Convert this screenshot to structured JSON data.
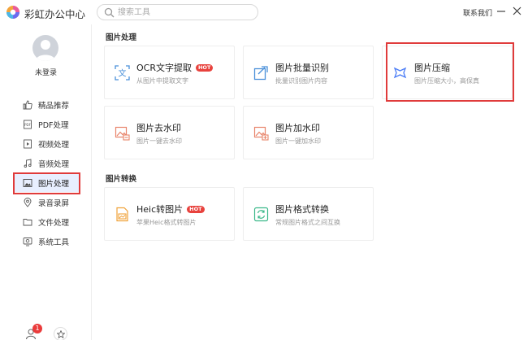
{
  "app": {
    "title": "彩虹办公中心"
  },
  "search": {
    "placeholder": "搜索工具"
  },
  "header": {
    "contact": "联系我们"
  },
  "user": {
    "login_status": "未登录",
    "notification_count": "1"
  },
  "sidebar": {
    "items": [
      {
        "label": "精品推荐",
        "icon": "thumbs-up-icon"
      },
      {
        "label": "PDF处理",
        "icon": "pdf-icon"
      },
      {
        "label": "视频处理",
        "icon": "video-icon"
      },
      {
        "label": "音频处理",
        "icon": "music-icon"
      },
      {
        "label": "图片处理",
        "icon": "image-icon",
        "active": true
      },
      {
        "label": "录音录屏",
        "icon": "location-icon"
      },
      {
        "label": "文件处理",
        "icon": "folder-icon"
      },
      {
        "label": "系统工具",
        "icon": "system-tool-icon"
      }
    ]
  },
  "sections": [
    {
      "title": "图片处理",
      "cards": [
        {
          "title": "OCR文字提取",
          "hot": "HOT",
          "desc": "从图片中提取文字",
          "icon": "ocr-icon"
        },
        {
          "title": "图片批量识别",
          "desc": "批量识别图片内容",
          "icon": "batch-recognize-icon"
        },
        {
          "title": "图片压缩",
          "desc": "图片压缩大小，高保真",
          "icon": "compress-icon"
        },
        {
          "title": "图片去水印",
          "desc": "图片一键去水印",
          "icon": "remove-watermark-icon"
        },
        {
          "title": "图片加水印",
          "desc": "图片一键加水印",
          "icon": "add-watermark-icon"
        }
      ]
    },
    {
      "title": "图片转换",
      "cards": [
        {
          "title": "Heic转图片",
          "hot": "HOT",
          "desc": "苹果Heic格式转图片",
          "icon": "heic-icon"
        },
        {
          "title": "图片格式转换",
          "desc": "常规图片格式之间互换",
          "icon": "format-convert-icon"
        }
      ]
    }
  ],
  "colors": {
    "accent": "#4a7cf6",
    "highlight": "#e03b3b",
    "active_bg": "#e8efff"
  }
}
